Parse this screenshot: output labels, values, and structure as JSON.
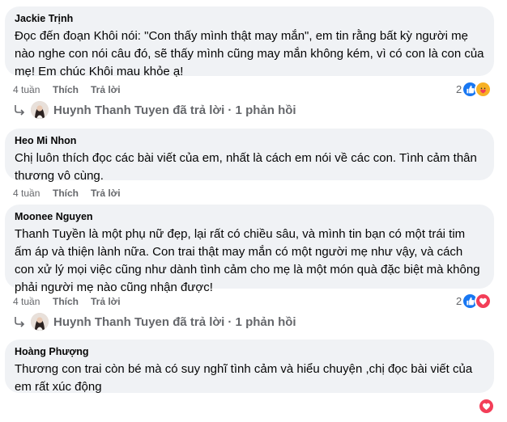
{
  "comments": [
    {
      "author": "Jackie Trịnh",
      "text": "Đọc đến đoạn Khôi nói: \"Con thấy mình thật may mắn\", em tin rằng bất kỳ người mẹ nào nghe con nói câu đó, sẽ thấy mình cũng may mắn không kém, vì có con là con của mẹ! Em chúc Khôi mau khỏe ạ!",
      "time": "4 tuần",
      "like": "Thích",
      "reply": "Trả lời",
      "reaction_count": "2",
      "reaction_icons": [
        "like-icon",
        "care-icon"
      ]
    },
    {
      "author": "Heo Mi Nhon",
      "text": "Chị luôn thích đọc các bài viết của em, nhất là cách em nói về các con. Tình cảm thân thương vô cùng.",
      "time": "4 tuần",
      "like": "Thích",
      "reply": "Trả lời"
    },
    {
      "author": "Moonee Nguyen",
      "text": "Thanh Tuyền là một phụ nữ đẹp, lại rất có chiều sâu, và mình tin bạn có một trái tim ấm áp và thiện lành nữa. Con trai thật may mắn có một người mẹ như vậy, và cách con xử lý mọi việc cũng như dành tình cảm cho mẹ là một món quà đặc biệt mà không phải người mẹ nào cũng nhận được!",
      "time": "4 tuần",
      "like": "Thích",
      "reply": "Trả lời",
      "reaction_count": "2",
      "reaction_icons": [
        "like-icon",
        "love-icon"
      ]
    },
    {
      "author": "Hoàng Phượng",
      "text": "Thương con trai còn bé mà có suy nghĩ tình cảm và hiểu chuyện ,chị đọc bài viết của em rất xúc động",
      "reaction_icons": [
        "love-icon"
      ]
    }
  ],
  "replies": [
    {
      "text": "Huynh Thanh Tuyen đã trả lời · 1 phản hồi"
    },
    {
      "text": "Huynh Thanh Tuyen đã trả lời · 1 phản hồi"
    }
  ],
  "colors": {
    "bubble": "#f0f2f5",
    "like": "#1877f2",
    "love": "#f33e58",
    "care": "#f7b125",
    "meta": "#65676b"
  }
}
